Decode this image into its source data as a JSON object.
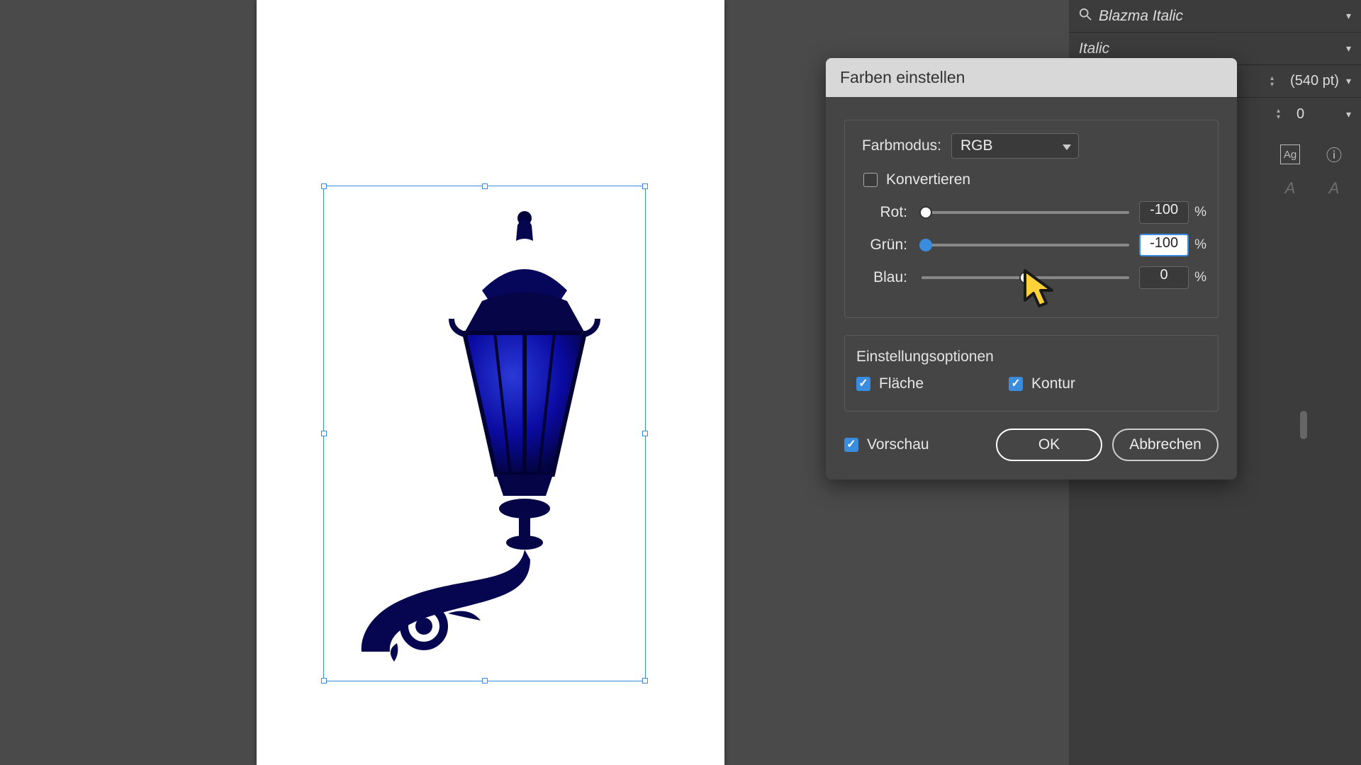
{
  "rightPanel": {
    "fontName": "Blazma Italic",
    "fontStyle": "Italic",
    "pointSize": "(540 pt)",
    "tracking": "0"
  },
  "dialog": {
    "title": "Farben einstellen",
    "modeLabel": "Farbmodus:",
    "modeValue": "RGB",
    "convertLabel": "Konvertieren",
    "sliders": {
      "red": {
        "label": "Rot:",
        "value": "-100",
        "pct": "%"
      },
      "green": {
        "label": "Grün:",
        "value": "-100",
        "pct": "%"
      },
      "blue": {
        "label": "Blau:",
        "value": "0",
        "pct": "%"
      }
    },
    "optsTitle": "Einstellungsoptionen",
    "fillLabel": "Fläche",
    "strokeLabel": "Kontur",
    "previewLabel": "Vorschau",
    "okLabel": "OK",
    "cancelLabel": "Abbrechen"
  }
}
